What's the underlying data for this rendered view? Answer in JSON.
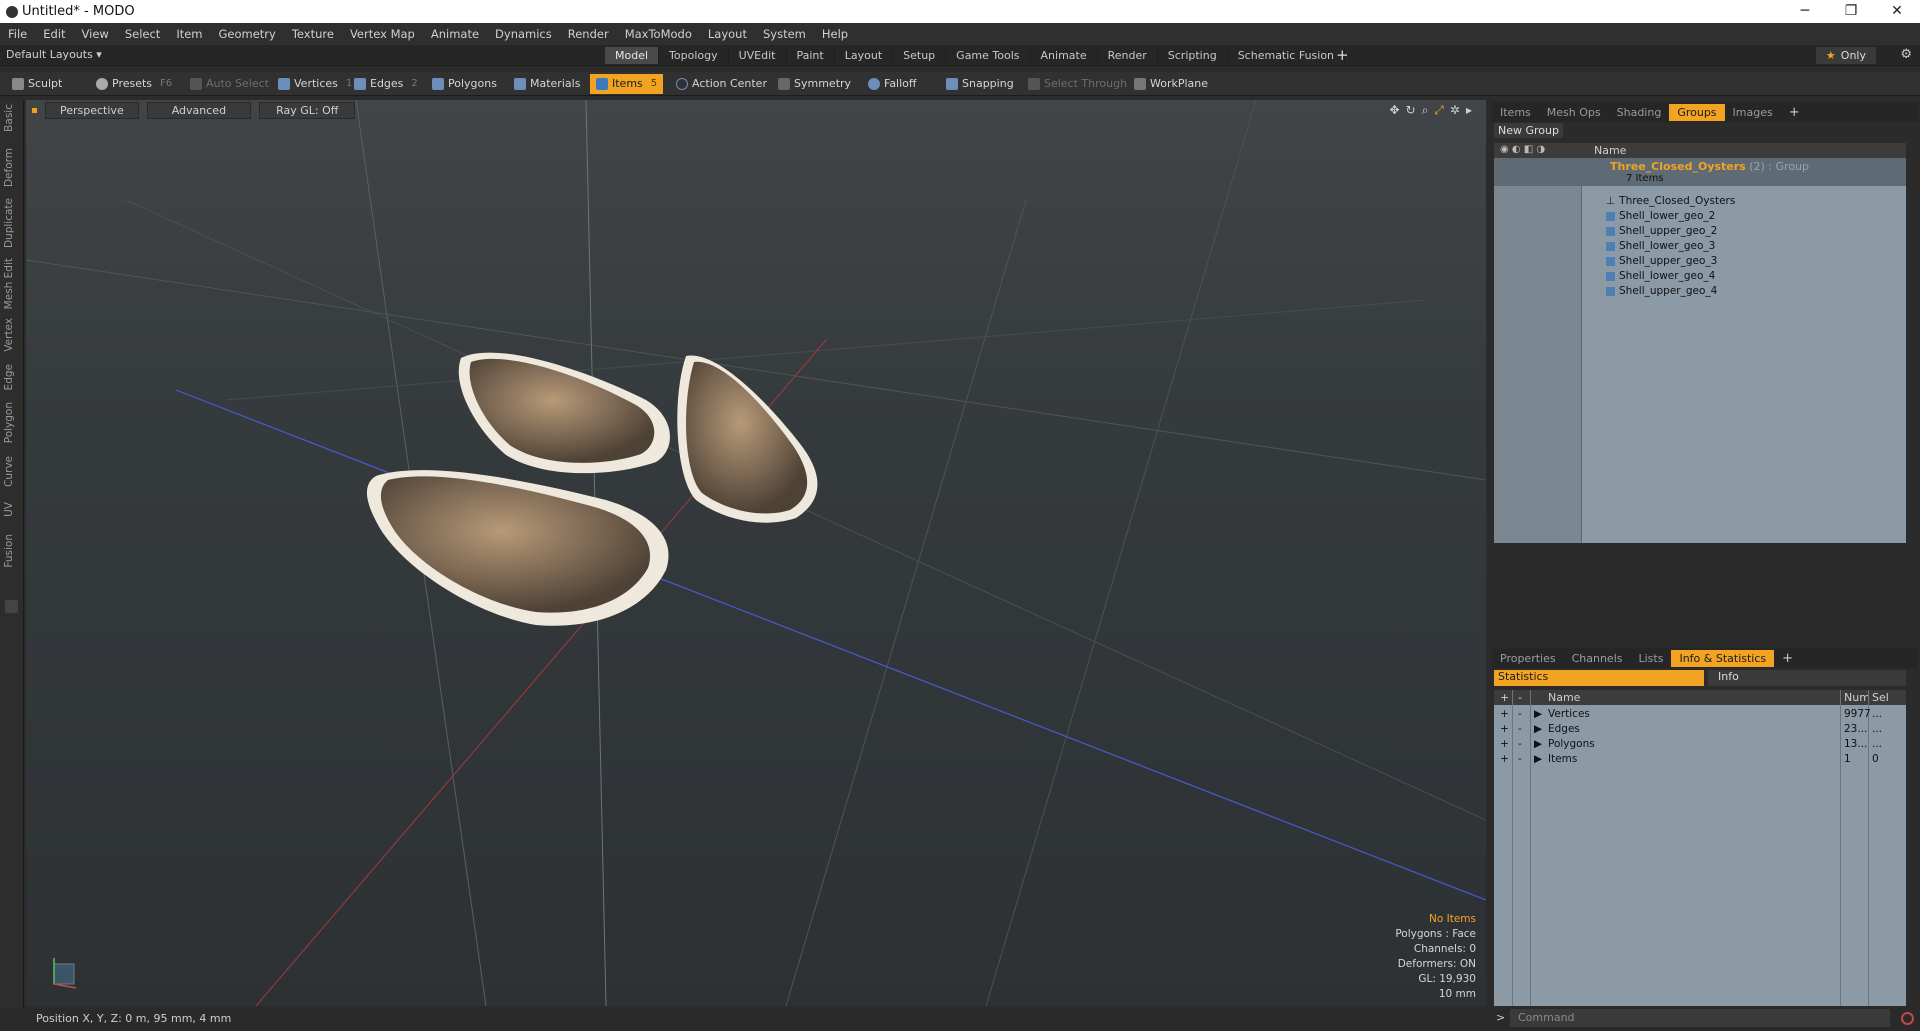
{
  "window": {
    "title": "Untitled* - MODO",
    "minimize": "─",
    "maximize": "❐",
    "close": "✕"
  },
  "menu": [
    "File",
    "Edit",
    "View",
    "Select",
    "Item",
    "Geometry",
    "Texture",
    "Vertex Map",
    "Animate",
    "Dynamics",
    "Render",
    "MaxToModo",
    "Layout",
    "System",
    "Help"
  ],
  "layout_bar": {
    "default_layouts": "Default Layouts ▾",
    "tabs": [
      "Model",
      "Topology",
      "UVEdit",
      "Paint",
      "Layout",
      "Setup",
      "Game Tools",
      "Animate",
      "Render",
      "Scripting",
      "Schematic Fusion"
    ],
    "active_tab": "Model",
    "only": "Only"
  },
  "toolbar": {
    "sculpt": "Sculpt",
    "presets": "Presets",
    "presets_key": "F6",
    "auto_select": "Auto Select",
    "vertices": "Vertices",
    "vertices_key": "1",
    "edges": "Edges",
    "edges_key": "2",
    "polygons": "Polygons",
    "materials": "Materials",
    "items": "Items",
    "items_key": "5",
    "action_center": "Action Center",
    "symmetry": "Symmetry",
    "falloff": "Falloff",
    "snapping": "Snapping",
    "select_through": "Select Through",
    "workplane": "WorkPlane"
  },
  "left_tabs": [
    "Basic",
    "Deform",
    "Duplicate",
    "Mesh Edit",
    "Vertex",
    "Edge",
    "Polygon",
    "Curve",
    "UV",
    "Fusion"
  ],
  "viewport": {
    "perspective": "Perspective",
    "advanced": "Advanced",
    "raygl": "Ray GL: Off",
    "info": {
      "no_items": "No Items",
      "polygons": "Polygons : Face",
      "channels": "Channels: 0",
      "deformers": "Deformers: ON",
      "gl": "GL: 19,930",
      "size": "10 mm"
    }
  },
  "status": {
    "position": "Position X, Y, Z:  0 m, 95 mm, 4 mm"
  },
  "groups_panel": {
    "tabs": [
      "Items",
      "Mesh Ops",
      "Shading",
      "Groups",
      "Images"
    ],
    "active": "Groups",
    "new_group": "New Group",
    "name_col": "Name",
    "group_name": "Three_Closed_Oysters",
    "group_suffix": " (2) : Group",
    "group_count": "7 Items",
    "items": [
      "Three_Closed_Oysters",
      "Shell_lower_geo_2",
      "Shell_upper_geo_2",
      "Shell_lower_geo_3",
      "Shell_upper_geo_3",
      "Shell_lower_geo_4",
      "Shell_upper_geo_4"
    ]
  },
  "props_panel": {
    "tabs": [
      "Properties",
      "Channels",
      "Lists",
      "Info & Statistics"
    ],
    "active": "Info & Statistics",
    "statistics": "Statistics",
    "info": "Info",
    "cols": {
      "name": "Name",
      "num": "Num",
      "sel": "Sel"
    },
    "rows": [
      {
        "name": "Vertices",
        "num": "9977",
        "sel": "..."
      },
      {
        "name": "Edges",
        "num": "23...",
        "sel": "..."
      },
      {
        "name": "Polygons",
        "num": "13...",
        "sel": "..."
      },
      {
        "name": "Items",
        "num": "1",
        "sel": "0"
      }
    ]
  },
  "command": {
    "placeholder": "Command"
  }
}
